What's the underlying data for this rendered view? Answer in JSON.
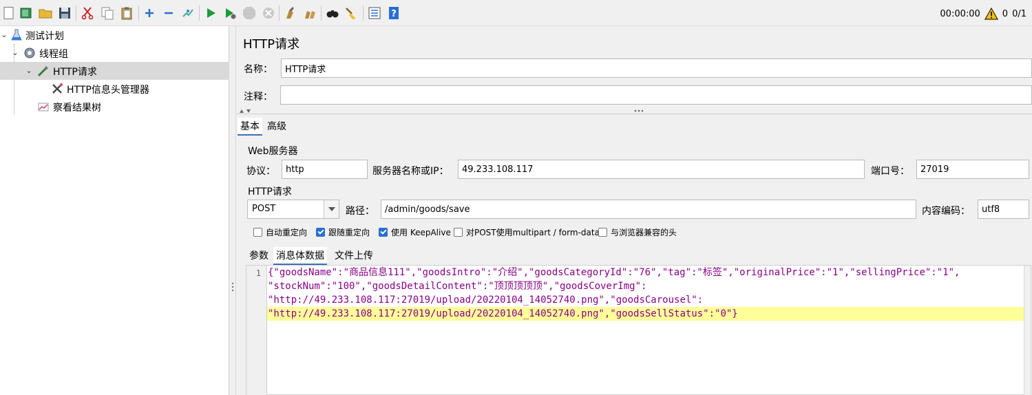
{
  "toolbar": {
    "icons": [
      "new-icon",
      "templates-icon",
      "open-icon",
      "save-icon",
      "cut-icon",
      "copy-icon",
      "paste-icon",
      "expand-icon",
      "collapse-icon",
      "toggle-icon",
      "start-icon",
      "start-no-pause-icon",
      "stop-icon",
      "shutdown-icon",
      "clear-icon",
      "clear-all-icon",
      "search-icon",
      "reset-search-icon",
      "function-helper-icon",
      "help-icon"
    ],
    "elapsed": "00:00:00",
    "warning_count": "0",
    "threads": "0/1"
  },
  "tree": {
    "items": [
      {
        "label": "测试计划",
        "icon": "test-plan-icon"
      },
      {
        "label": "线程组",
        "icon": "thread-group-icon"
      },
      {
        "label": "HTTP请求",
        "icon": "sampler-icon"
      },
      {
        "label": "HTTP信息头管理器",
        "icon": "header-manager-icon"
      },
      {
        "label": "察看结果树",
        "icon": "results-tree-icon"
      }
    ]
  },
  "panel": {
    "title": "HTTP请求",
    "name_label": "名称：",
    "name_value": "HTTP请求",
    "comment_label": "注释：",
    "comment_value": "",
    "tabs": [
      "基本",
      "高级"
    ],
    "web_server": {
      "group_title": "Web服务器",
      "protocol_label": "协议：",
      "protocol_value": "http",
      "server_label": "服务器名称或IP：",
      "server_value": "49.233.108.117",
      "port_label": "端口号：",
      "port_value": "27019"
    },
    "http_request": {
      "group_title": "HTTP请求",
      "method": "POST",
      "path_label": "路径：",
      "path_value": "/admin/goods/save",
      "encoding_label": "内容编码：",
      "encoding_value": "utf8"
    },
    "checkboxes": [
      {
        "label": "自动重定向",
        "checked": false
      },
      {
        "label": "跟随重定向",
        "checked": true
      },
      {
        "label": "使用 KeepAlive",
        "checked": true
      },
      {
        "label": "对POST使用multipart / form-data",
        "checked": false
      },
      {
        "label": "与浏览器兼容的头",
        "checked": false
      }
    ],
    "body_tabs": [
      "参数",
      "消息体数据",
      "文件上传"
    ],
    "editor": {
      "line_number": "1",
      "lines": [
        "{\"goodsName\":\"商品信息111\",\"goodsIntro\":\"介绍\",\"goodsCategoryId\":\"76\",\"tag\":\"标签\",\"originalPrice\":\"1\",\"sellingPrice\":\"1\",",
        "\"stockNum\":\"100\",\"goodsDetailContent\":\"顶顶顶顶顶\",\"goodsCoverImg\":",
        "\"http://49.233.108.117:27019/upload/20220104_14052740.png\",\"goodsCarousel\":",
        "\"http://49.233.108.117:27019/upload/20220104_14052740.png\",\"goodsSellStatus\":\"0\"}"
      ]
    }
  }
}
